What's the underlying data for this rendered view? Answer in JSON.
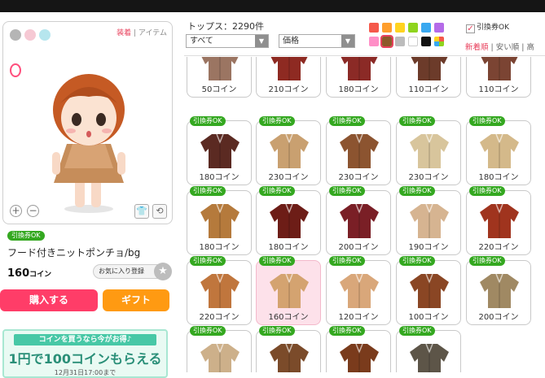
{
  "preview": {
    "color_swatches": [
      "#ffffff",
      "#b5b5b5",
      "#f6c9d4",
      "#b6e6ee"
    ],
    "view_on": "装着",
    "view_sep": " | ",
    "view_off": "アイテム",
    "zoom_in": "+",
    "zoom_out": "−",
    "tool_shirt": "👕",
    "tool_rotate": "⟲"
  },
  "item": {
    "ticket_badge": "引換券OK",
    "name": "フード付きニットポンチョ/bg",
    "price": "160",
    "price_unit": "コイン",
    "favorite_label": "お気に入り登録",
    "favorite_icon": "★",
    "buy_label": "購入する",
    "gift_label": "ギフト"
  },
  "promo": {
    "head": "コインを買うなら今がお得♪",
    "main": "1円で100コインもらえる",
    "sub": "12月31日17:00まで"
  },
  "header": {
    "category_title": "トップス：2290件",
    "filter_all": "すべて",
    "filter_price": "価格",
    "select_arrow": "▼",
    "ticket_ok_label": "引換券OK",
    "ticket_ok_check": "✓",
    "sort_new": "新着順",
    "sort_sep": " | ",
    "sort_cheap": "安い順",
    "sort_high": "高",
    "colors": [
      "#f5584a",
      "#ff9e2c",
      "#ffd320",
      "#8fd41e",
      "#39a8f0",
      "#b56be8",
      "#ff8fc7",
      "#8d5a2a",
      "#bcbcbc",
      "#ffffff",
      "#111111",
      "multi"
    ]
  },
  "grid": {
    "ticket_label": "引換券OK",
    "rows": [
      {
        "items": [
          {
            "price": "50コイン",
            "ticket": false,
            "color": "#9b7562"
          },
          {
            "price": "210コイン",
            "ticket": false,
            "color": "#8e2a22"
          },
          {
            "price": "180コイン",
            "ticket": false,
            "color": "#8b2a26"
          },
          {
            "price": "110コイン",
            "ticket": false,
            "color": "#6c3b2a"
          },
          {
            "price": "110コイン",
            "ticket": false,
            "color": "#7b4433"
          }
        ]
      },
      {
        "items": [
          {
            "price": "180コイン",
            "ticket": true,
            "color": "#5b2a22"
          },
          {
            "price": "230コイン",
            "ticket": true,
            "color": "#c9a070"
          },
          {
            "price": "230コイン",
            "ticket": true,
            "color": "#8c5430"
          },
          {
            "price": "230コイン",
            "ticket": true,
            "color": "#d8c59c"
          },
          {
            "price": "180コイン",
            "ticket": true,
            "color": "#d4b98a"
          }
        ]
      },
      {
        "items": [
          {
            "price": "180コイン",
            "ticket": true,
            "color": "#b57a3c"
          },
          {
            "price": "180コイン",
            "ticket": true,
            "color": "#6d1d17"
          },
          {
            "price": "200コイン",
            "ticket": true,
            "color": "#7a1f26"
          },
          {
            "price": "190コイン",
            "ticket": true,
            "color": "#d6b491"
          },
          {
            "price": "220コイン",
            "ticket": true,
            "color": "#a0341e"
          }
        ]
      },
      {
        "items": [
          {
            "price": "220コイン",
            "ticket": true,
            "color": "#c0763d"
          },
          {
            "price": "160コイン",
            "ticket": true,
            "color": "#d4a370",
            "selected": true
          },
          {
            "price": "120コイン",
            "ticket": true,
            "color": "#d9a77a"
          },
          {
            "price": "100コイン",
            "ticket": true,
            "color": "#8a4624"
          },
          {
            "price": "200コイン",
            "ticket": true,
            "color": "#a08963"
          }
        ]
      },
      {
        "items": [
          {
            "price": "",
            "ticket": true,
            "color": "#cdb08a"
          },
          {
            "price": "",
            "ticket": true,
            "color": "#7b4b2a"
          },
          {
            "price": "",
            "ticket": true,
            "color": "#7a3b1c"
          },
          {
            "price": "",
            "ticket": true,
            "color": "#5d5548"
          }
        ]
      }
    ]
  }
}
